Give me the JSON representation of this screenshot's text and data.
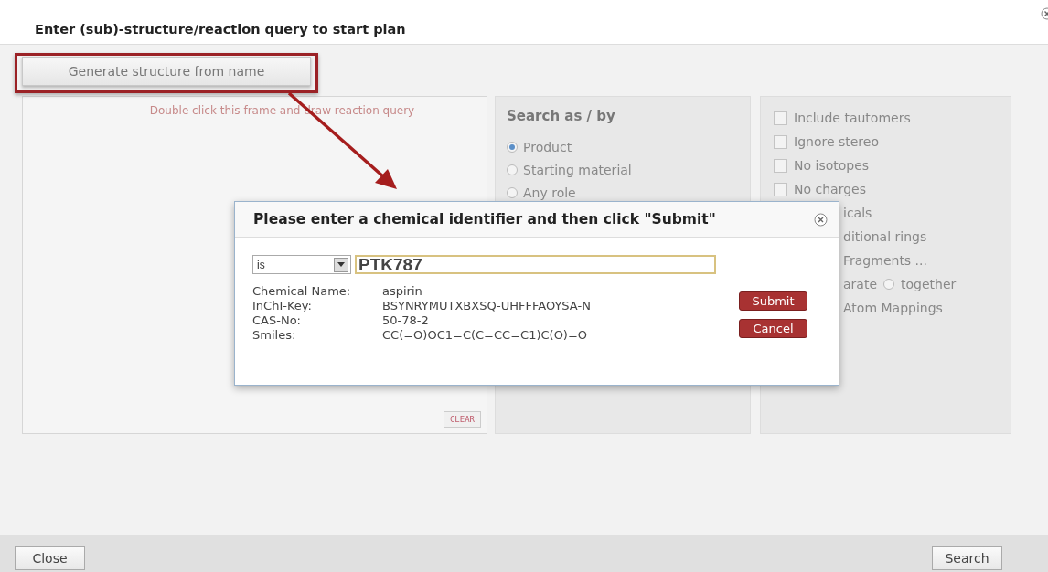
{
  "dialog": {
    "title": "Enter (sub)-structure/reaction query to start plan",
    "generate_button": "Generate structure from name",
    "draw_frame": {
      "hint": "Double click this frame and draw reaction query",
      "clear_button": "CLEAR"
    },
    "search_as": {
      "heading": "Search as / by",
      "options": [
        {
          "label": "Product",
          "selected": true
        },
        {
          "label": "Starting material",
          "selected": false
        },
        {
          "label": "Any role",
          "selected": false
        }
      ]
    },
    "options": [
      {
        "kind": "checkbox",
        "label": "Include tautomers",
        "checked": false
      },
      {
        "kind": "checkbox",
        "label": "Ignore stereo",
        "checked": false
      },
      {
        "kind": "checkbox",
        "label": "No isotopes",
        "checked": false
      },
      {
        "kind": "checkbox",
        "label": "No charges",
        "checked": false
      },
      {
        "kind": "partial",
        "label": "icals"
      },
      {
        "kind": "partial",
        "label": "ditional rings"
      },
      {
        "kind": "partial",
        "label": "Fragments ..."
      },
      {
        "kind": "radios",
        "label": "arate",
        "choices": [
          {
            "label": "together",
            "selected": false
          }
        ]
      },
      {
        "kind": "partial",
        "label": "Atom Mappings"
      }
    ],
    "buttons": [
      "Close",
      "Search"
    ]
  },
  "identifier_popup": {
    "title": "Please enter a chemical identifier and then click \"Submit\"",
    "match_select": "is",
    "query": "PTK787",
    "details": [
      {
        "label": "Chemical Name:",
        "value": "aspirin"
      },
      {
        "label": "InChI-Key:",
        "value": "BSYNRYMUTXBXSQ-UHFFFAOYSA-N"
      },
      {
        "label": "CAS-No:",
        "value": "50-78-2"
      },
      {
        "label": "Smiles:",
        "value": "CC(=O)OC1=C(C=CC=C1)C(O)=O"
      }
    ],
    "buttons": [
      "Submit",
      "Cancel"
    ]
  }
}
